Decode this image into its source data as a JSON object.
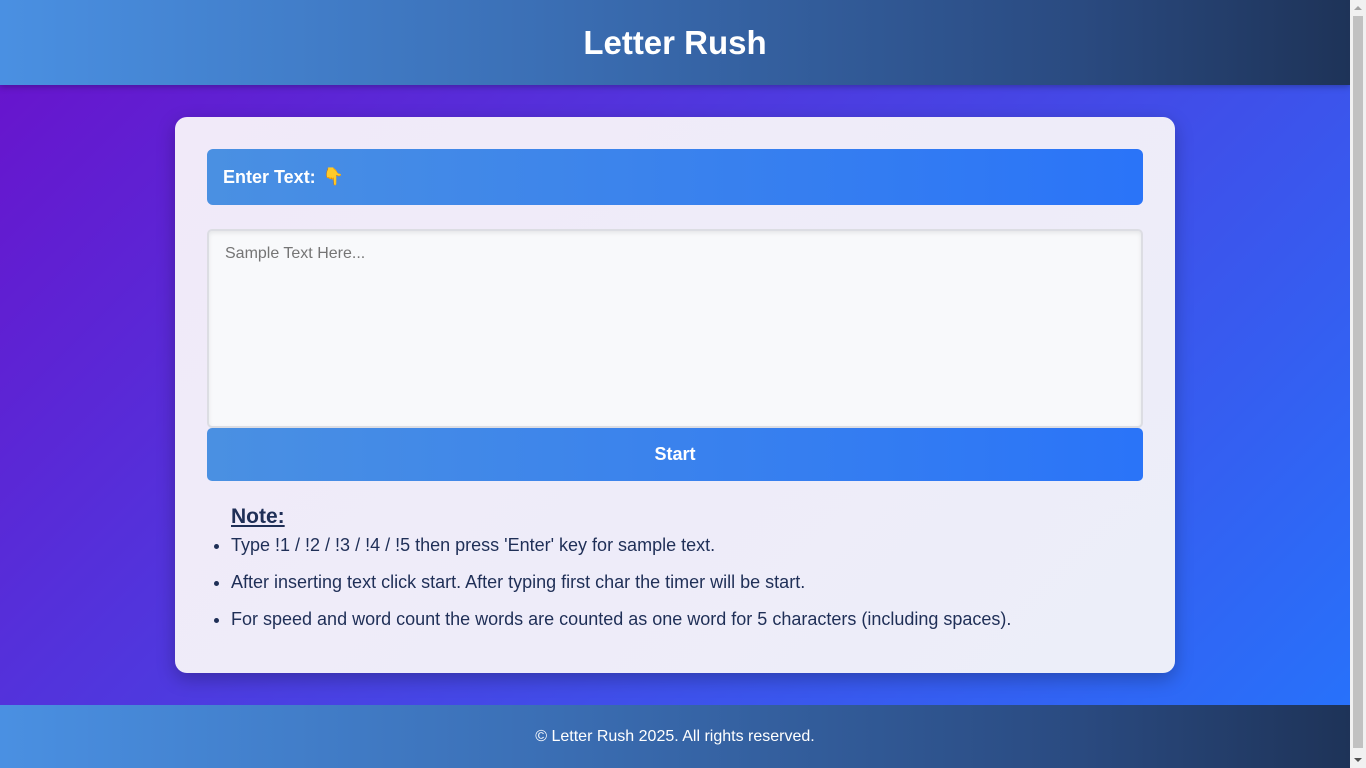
{
  "header": {
    "title": "Letter Rush"
  },
  "input_section": {
    "label": "Enter Text:",
    "label_emoji": "👇",
    "textarea_value": "",
    "textarea_placeholder": "Sample Text Here...",
    "start_label": "Start"
  },
  "note": {
    "title": "Note:",
    "items": [
      "Type !1 / !2 / !3 / !4 / !5 then press 'Enter' key for sample text.",
      "After inserting text click start. After typing first char the timer will be start.",
      "For speed and word count the words are counted as one word for 5 characters (including spaces)."
    ]
  },
  "footer": {
    "text": "© Letter Rush 2025. All rights reserved."
  },
  "colors": {
    "background_start": "#6a11cb",
    "background_end": "#2575fc",
    "accent_blue": "#2a74f8",
    "header_light": "#4a90e2",
    "header_dark": "#1e3358",
    "note_text": "#1f2f57"
  },
  "icons": {
    "label_icon": "pointing-down-hand-emoji"
  }
}
